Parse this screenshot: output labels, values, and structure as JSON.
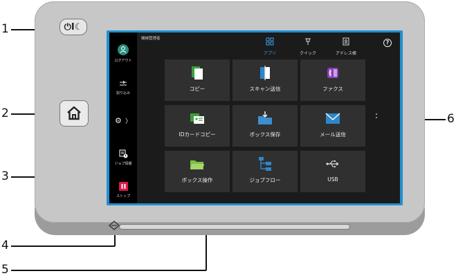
{
  "callouts": [
    "1",
    "2",
    "3",
    "4",
    "5",
    "6"
  ],
  "power_button": {
    "label": "⏻I☾"
  },
  "screen": {
    "admin_label": "機械管理者",
    "sidebar": {
      "logout": "ログアウト",
      "interrupt": "割り込み",
      "job_status": "ジョブ情報",
      "stop": "ストップ",
      "settings_chevron": "〉"
    },
    "top_tabs": [
      {
        "label": "アプリ"
      },
      {
        "label": "クイック"
      },
      {
        "label": "アドレス帳"
      }
    ],
    "help": "?",
    "apps": [
      {
        "label": "コピー",
        "icon": "copy-icon"
      },
      {
        "label": "スキャン送信",
        "icon": "scan-icon"
      },
      {
        "label": "ファクス",
        "icon": "fax-icon"
      },
      {
        "label": "IDカードコピー",
        "icon": "id-card-icon"
      },
      {
        "label": "ボックス保存",
        "icon": "folder-save-icon"
      },
      {
        "label": "メール送信",
        "icon": "mail-icon"
      },
      {
        "label": "ボックス操作",
        "icon": "folder-icon"
      },
      {
        "label": "ジョブフロー",
        "icon": "job-flow-icon"
      },
      {
        "label": "USB",
        "icon": "usb-icon"
      }
    ],
    "colors": {
      "accent": "#1f8fd0",
      "tab_active": "#3aa0e8",
      "logout_circle": "#2a8c7a",
      "stop_red": "#d9184b"
    }
  }
}
